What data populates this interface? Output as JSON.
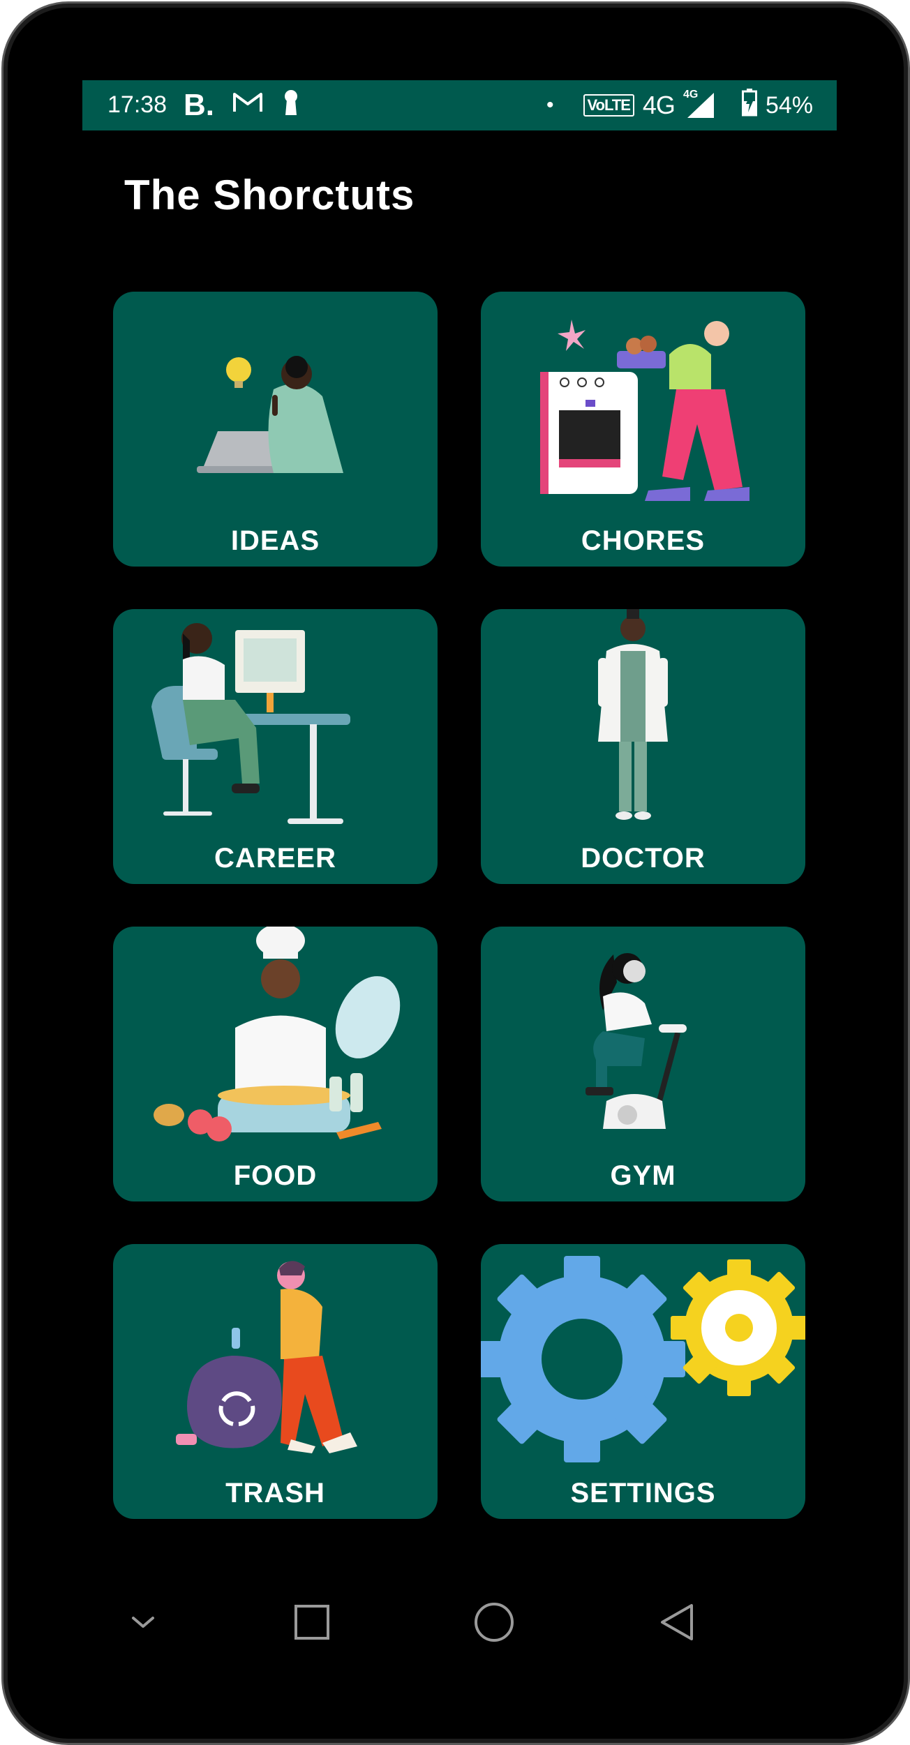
{
  "status_bar": {
    "time": "17:38",
    "left_icons": [
      "b-icon",
      "gmail-icon",
      "keyhole-icon"
    ],
    "volte": "VoLTE",
    "network": "4G",
    "network_small": "4G",
    "battery": "54%"
  },
  "app": {
    "title": "The Shorctuts"
  },
  "cards": [
    {
      "label": "IDEAS",
      "icon": "ideas-illustration"
    },
    {
      "label": "CHORES",
      "icon": "chores-illustration"
    },
    {
      "label": "CAREER",
      "icon": "career-illustration"
    },
    {
      "label": "DOCTOR",
      "icon": "doctor-illustration"
    },
    {
      "label": "FOOD",
      "icon": "food-illustration"
    },
    {
      "label": "GYM",
      "icon": "gym-illustration"
    },
    {
      "label": "TRASH",
      "icon": "trash-illustration"
    },
    {
      "label": "SETTINGS",
      "icon": "gears-illustration"
    }
  ],
  "colors": {
    "card_bg": "#005a4e",
    "status_bg": "#005a4e",
    "screen_bg": "#000000",
    "label_text": "#ffffff"
  },
  "nav_bar": {
    "icons": [
      "chevron-down-icon",
      "recents-square-icon",
      "home-circle-icon",
      "back-triangle-icon"
    ]
  }
}
